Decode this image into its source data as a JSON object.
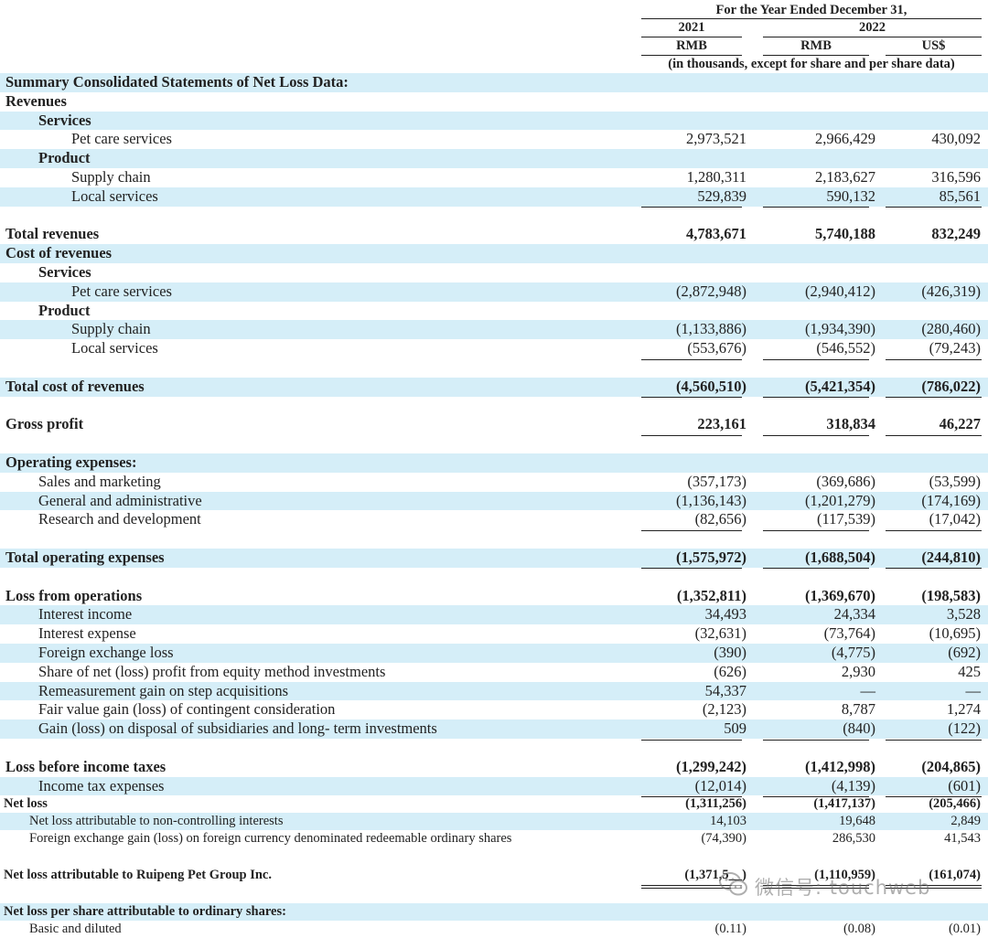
{
  "header": {
    "period": "For the Year Ended December 31,",
    "year_a": "2021",
    "year_b": "2022",
    "cur_a": "RMB",
    "cur_b": "RMB",
    "cur_c": "US$",
    "units": "(in thousands, except for share and per share data)"
  },
  "rows": [
    {
      "label": "Summary Consolidated Statements of Net Loss Data:",
      "indent": 0,
      "bold": true,
      "shade": true,
      "v": [
        "",
        "",
        ""
      ]
    },
    {
      "label": "Revenues",
      "indent": 0,
      "bold": true,
      "shade": false,
      "v": [
        "",
        "",
        ""
      ]
    },
    {
      "label": "Services",
      "indent": 1,
      "bold": true,
      "shade": true,
      "v": [
        "",
        "",
        ""
      ]
    },
    {
      "label": "Pet care services",
      "indent": 2,
      "bold": false,
      "shade": false,
      "v": [
        "2,973,521",
        "2,966,429",
        "430,092"
      ]
    },
    {
      "label": "Product",
      "indent": 1,
      "bold": true,
      "shade": true,
      "v": [
        "",
        "",
        ""
      ]
    },
    {
      "label": "Supply chain",
      "indent": 2,
      "bold": false,
      "shade": false,
      "v": [
        "1,280,311",
        "2,183,627",
        "316,596"
      ]
    },
    {
      "label": "Local services",
      "indent": 2,
      "bold": false,
      "shade": true,
      "v": [
        "529,839",
        "590,132",
        "85,561"
      ],
      "underline": "single"
    },
    {
      "label": "",
      "indent": 0,
      "bold": false,
      "shade": false,
      "v": [
        "",
        "",
        ""
      ]
    },
    {
      "label": "Total revenues",
      "indent": 0,
      "bold": true,
      "shade": false,
      "v": [
        "4,783,671",
        "5,740,188",
        "832,249"
      ]
    },
    {
      "label": "Cost of revenues",
      "indent": 0,
      "bold": true,
      "shade": true,
      "v": [
        "",
        "",
        ""
      ]
    },
    {
      "label": "Services",
      "indent": 1,
      "bold": true,
      "shade": false,
      "v": [
        "",
        "",
        ""
      ]
    },
    {
      "label": "Pet care services",
      "indent": 2,
      "bold": false,
      "shade": true,
      "v": [
        "(2,872,948)",
        "(2,940,412)",
        "(426,319)"
      ]
    },
    {
      "label": "Product",
      "indent": 1,
      "bold": true,
      "shade": false,
      "v": [
        "",
        "",
        ""
      ]
    },
    {
      "label": "Supply chain",
      "indent": 2,
      "bold": false,
      "shade": true,
      "v": [
        "(1,133,886)",
        "(1,934,390)",
        "(280,460)"
      ]
    },
    {
      "label": "Local services",
      "indent": 2,
      "bold": false,
      "shade": false,
      "v": [
        "(553,676)",
        "(546,552)",
        "(79,243)"
      ],
      "underline": "single"
    },
    {
      "label": "",
      "indent": 0,
      "bold": false,
      "shade": false,
      "v": [
        "",
        "",
        ""
      ]
    },
    {
      "label": "Total cost of revenues",
      "indent": 0,
      "bold": true,
      "shade": true,
      "v": [
        "(4,560,510)",
        "(5,421,354)",
        "(786,022)"
      ],
      "underline": "single"
    },
    {
      "label": "",
      "indent": 0,
      "bold": false,
      "shade": false,
      "v": [
        "",
        "",
        ""
      ]
    },
    {
      "label": "Gross profit",
      "indent": 0,
      "bold": true,
      "shade": false,
      "v": [
        "223,161",
        "318,834",
        "46,227"
      ],
      "underline": "single"
    },
    {
      "label": "",
      "indent": 0,
      "bold": false,
      "shade": false,
      "v": [
        "",
        "",
        ""
      ]
    },
    {
      "label": "Operating expenses:",
      "indent": 0,
      "bold": true,
      "shade": true,
      "v": [
        "",
        "",
        ""
      ]
    },
    {
      "label": "Sales and marketing",
      "indent": 1,
      "bold": false,
      "shade": false,
      "v": [
        "(357,173)",
        "(369,686)",
        "(53,599)"
      ]
    },
    {
      "label": "General and administrative",
      "indent": 1,
      "bold": false,
      "shade": true,
      "v": [
        "(1,136,143)",
        "(1,201,279)",
        "(174,169)"
      ]
    },
    {
      "label": "Research and development",
      "indent": 1,
      "bold": false,
      "shade": false,
      "v": [
        "(82,656)",
        "(117,539)",
        "(17,042)"
      ],
      "underline": "single"
    },
    {
      "label": "",
      "indent": 0,
      "bold": false,
      "shade": false,
      "v": [
        "",
        "",
        ""
      ]
    },
    {
      "label": "Total operating expenses",
      "indent": 0,
      "bold": true,
      "shade": true,
      "v": [
        "(1,575,972)",
        "(1,688,504)",
        "(244,810)"
      ],
      "underline": "single"
    },
    {
      "label": "",
      "indent": 0,
      "bold": false,
      "shade": false,
      "v": [
        "",
        "",
        ""
      ]
    },
    {
      "label": "Loss from operations",
      "indent": 0,
      "bold": true,
      "shade": false,
      "v": [
        "(1,352,811)",
        "(1,369,670)",
        "(198,583)"
      ]
    },
    {
      "label": "Interest income",
      "indent": 1,
      "bold": false,
      "shade": true,
      "v": [
        "34,493",
        "24,334",
        "3,528"
      ]
    },
    {
      "label": "Interest expense",
      "indent": 1,
      "bold": false,
      "shade": false,
      "v": [
        "(32,631)",
        "(73,764)",
        "(10,695)"
      ]
    },
    {
      "label": "Foreign exchange loss",
      "indent": 1,
      "bold": false,
      "shade": true,
      "v": [
        "(390)",
        "(4,775)",
        "(692)"
      ]
    },
    {
      "label": "Share of net (loss) profit from equity method investments",
      "indent": 1,
      "bold": false,
      "shade": false,
      "v": [
        "(626)",
        "2,930",
        "425"
      ]
    },
    {
      "label": "Remeasurement gain on step acquisitions",
      "indent": 1,
      "bold": false,
      "shade": true,
      "v": [
        "54,337",
        "—",
        "—"
      ]
    },
    {
      "label": "Fair value gain (loss) of contingent consideration",
      "indent": 1,
      "bold": false,
      "shade": false,
      "v": [
        "(2,123)",
        "8,787",
        "1,274"
      ]
    },
    {
      "label": "Gain (loss) on disposal of subsidiaries and long- term investments",
      "indent": 1,
      "bold": false,
      "shade": true,
      "v": [
        "509",
        "(840)",
        "(122)"
      ],
      "underline": "single"
    },
    {
      "label": "",
      "indent": 0,
      "bold": false,
      "shade": false,
      "v": [
        "",
        "",
        ""
      ]
    },
    {
      "label": "Loss before income taxes",
      "indent": 0,
      "bold": true,
      "shade": false,
      "v": [
        "(1,299,242)",
        "(1,412,998)",
        "(204,865)"
      ]
    },
    {
      "label": "Income tax expenses",
      "indent": 1,
      "bold": false,
      "shade": true,
      "v": [
        "(12,014)",
        "(4,139)",
        "(601)"
      ],
      "underline": "single"
    },
    {
      "label": "Net loss",
      "indent": 0,
      "bold": true,
      "shade": false,
      "small": true,
      "v": [
        "(1,311,256)",
        "(1,417,137)",
        "(205,466)"
      ]
    },
    {
      "label": "Net loss attributable to non-controlling interests",
      "indent": 1,
      "bold": false,
      "shade": true,
      "small": true,
      "v": [
        "14,103",
        "19,648",
        "2,849"
      ]
    },
    {
      "label": "Foreign exchange gain (loss) on foreign currency denominated redeemable ordinary shares",
      "indent": 1,
      "bold": false,
      "shade": false,
      "small": true,
      "v": [
        "(74,390)",
        "286,530",
        "41,543"
      ]
    },
    {
      "label": "",
      "indent": 0,
      "bold": false,
      "shade": false,
      "v": [
        "",
        "",
        ""
      ]
    },
    {
      "label": "Net loss attributable to Ruipeng Pet Group Inc.",
      "indent": 0,
      "bold": true,
      "shade": false,
      "small": true,
      "v": [
        "(1,371,5__)",
        "(1,110,959)",
        "(161,074)"
      ],
      "underline": "double"
    },
    {
      "label": "",
      "indent": 0,
      "bold": false,
      "shade": false,
      "v": [
        "",
        "",
        ""
      ]
    },
    {
      "label": "Net loss per share attributable to ordinary shares:",
      "indent": 0,
      "bold": true,
      "shade": true,
      "small": true,
      "v": [
        "",
        "",
        ""
      ]
    },
    {
      "label": "Basic and diluted",
      "indent": 1,
      "bold": false,
      "shade": false,
      "small": true,
      "v": [
        "(0.11)",
        "(0.08)",
        "(0.01)"
      ]
    }
  ],
  "watermark": {
    "icon": "wechat-icon",
    "text": "微信号: touchweb"
  }
}
